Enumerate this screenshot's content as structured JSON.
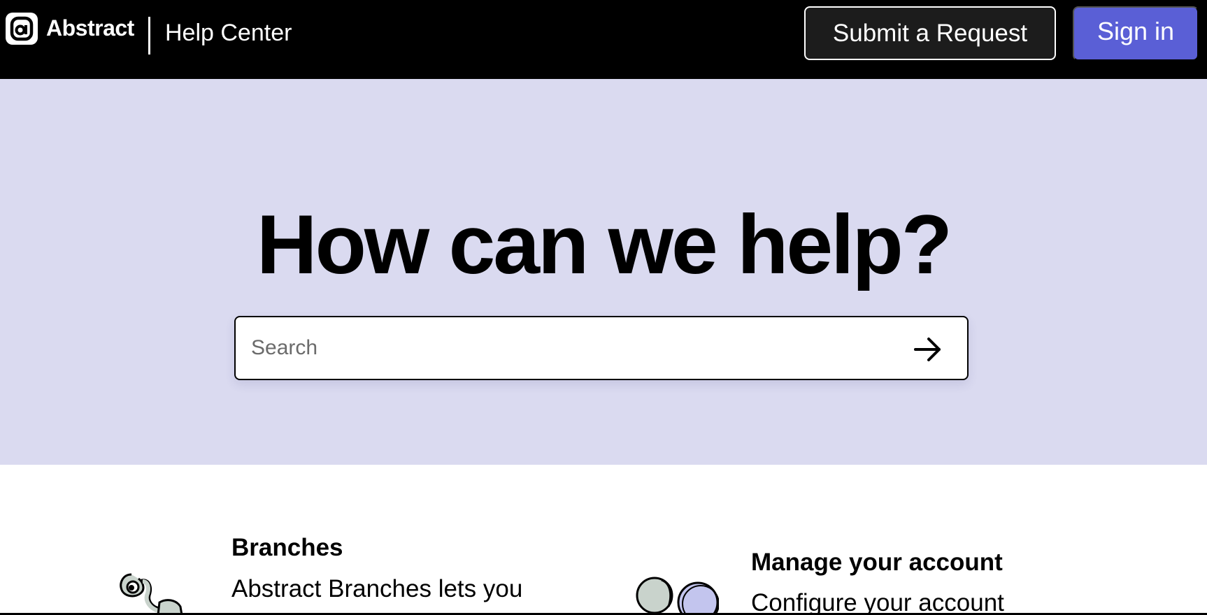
{
  "header": {
    "brand": "Abstract",
    "section_title": "Help Center",
    "submit_label": "Submit a Request",
    "signin_label": "Sign in"
  },
  "hero": {
    "title": "How can we help?",
    "search_placeholder": "Search"
  },
  "categories": [
    {
      "title": "Branches",
      "description": "Abstract Branches lets you"
    },
    {
      "title": "Manage your account",
      "description": "Configure your account"
    }
  ],
  "colors": {
    "header_bg": "#000000",
    "hero_bg": "#dadaf0",
    "signin_bg": "#5a5fd6"
  },
  "icons": {
    "logo": "abstract-logo-icon",
    "search_submit": "arrow-right-icon"
  }
}
